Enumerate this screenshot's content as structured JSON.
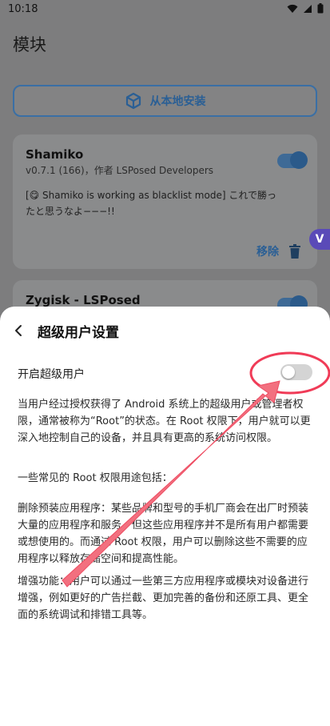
{
  "status_bar": {
    "time": "10:18"
  },
  "background": {
    "title": "模块",
    "install_button": "从本地安装",
    "module1": {
      "name": "Shamiko",
      "subtitle": "v0.7.1 (166)，作者 LSPosed Developers",
      "description": "[😋 Shamiko is working as blacklist mode] これで勝ったと思うなよ−−−!!",
      "remove_label": "移除"
    },
    "module2": {
      "name": "Zygisk - LSPosed"
    }
  },
  "sheet": {
    "title": "超级用户设置",
    "toggle_label": "开启超级用户",
    "paragraphs": [
      "当用户经过授权获得了 Android 系统上的超级用户或管理者权限，通常被称为“Root”的状态。在 Root 权限下，用户就可以更深入地控制自己的设备，并且具有更高的系统访问权限。",
      "一些常见的 Root 权限用途包括：",
      "删除预装应用程序：某些品牌和型号的手机厂商会在出厂时预装大量的应用程序和服务，但这些应用程序并不是所有用户都需要或想使用的。而通过 Root 权限，用户可以删除这些不需要的应用程序以释放存储空间和提高性能。",
      "增强功能：用户可以通过一些第三方应用程序或模块对设备进行增强，例如更好的广告拦截、更加完善的备份和还原工具、更全面的系统调试和排错工具等。"
    ]
  }
}
